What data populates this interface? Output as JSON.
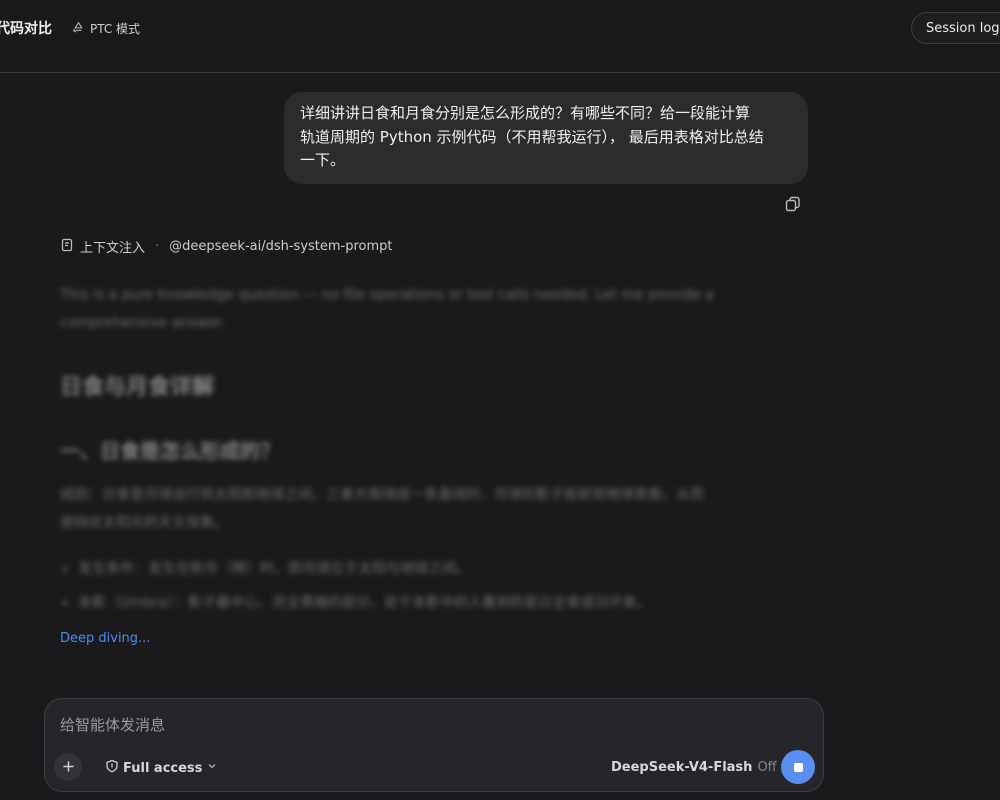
{
  "header": {
    "title": "代码对比",
    "mode_label": "PTC 模式",
    "session_button": "Session log"
  },
  "user_message": {
    "lines": [
      "详细讲讲日食和月食分别是怎么形成的？有哪些不同？给一段能计算",
      "轨道周期的 Python 示例代码（不用帮我运行），  最后用表格对比总结",
      "一下。"
    ]
  },
  "context": {
    "label": "上下文注入",
    "separator": "·",
    "source": "@deepseek-ai/dsh-system-prompt"
  },
  "response": {
    "intro_lines": [
      "This is a pure knowledge question — no file operations or tool calls needed. Let me provide a",
      "comprehensive answer."
    ],
    "heading": "日食与月食详解",
    "subheading": "一、日食是怎么形成的？",
    "para_lines": [
      "成因：日食是月球运行到太阳和地球之间，三者大致排成一条直线时，月球的影子投射到地球表面，从而",
      "遮挡住太阳光的天文现象。"
    ],
    "bullets": [
      "发生条件：发生在新月（朔）时，即月球位于太阳与地球之间。",
      "本影（Umbra）：影子最中心、完全黑暗的部分，处于本影中的人看到的是日全食或日环食。"
    ],
    "status": "Deep diving..."
  },
  "composer": {
    "placeholder": "给智能体发消息",
    "value": "",
    "access_label": "Full access",
    "model_name": "DeepSeek-V4-Flash",
    "model_state": "Off"
  },
  "colors": {
    "background": "#1a1a1c",
    "bubble": "#2c2c2f",
    "accent_link": "#4d8cf5",
    "stop_button": "#5b8fee"
  }
}
